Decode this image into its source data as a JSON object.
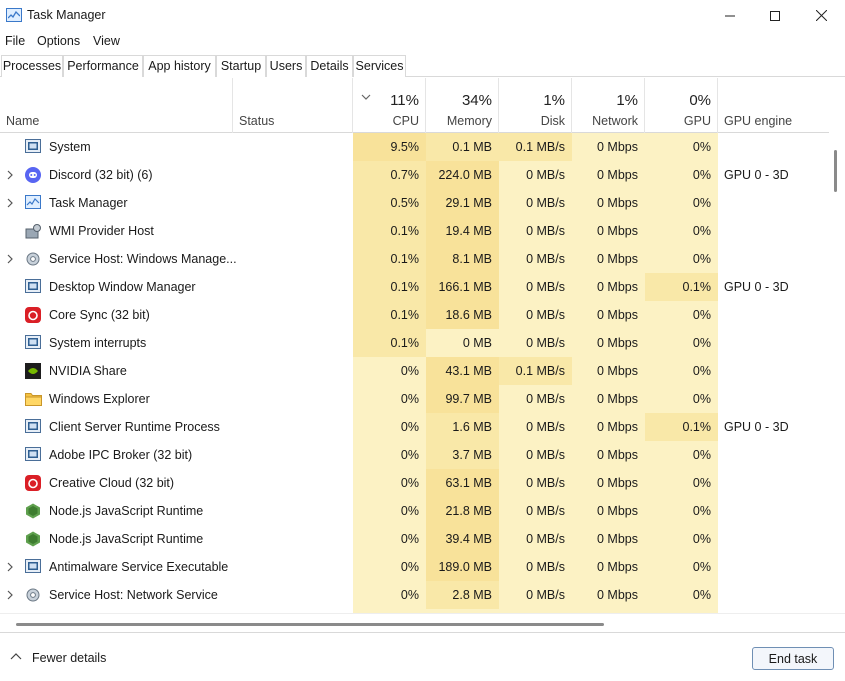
{
  "window": {
    "title": "Task Manager"
  },
  "menu": [
    "File",
    "Options",
    "View"
  ],
  "tabs": [
    "Processes",
    "Performance",
    "App history",
    "Startup",
    "Users",
    "Details",
    "Services"
  ],
  "columns": {
    "name": "Name",
    "status": "Status",
    "cpu": {
      "pct": "11%",
      "label": "CPU"
    },
    "memory": {
      "pct": "34%",
      "label": "Memory"
    },
    "disk": {
      "pct": "1%",
      "label": "Disk"
    },
    "network": {
      "pct": "1%",
      "label": "Network"
    },
    "gpu": {
      "pct": "0%",
      "label": "GPU"
    },
    "gpu_engine": "GPU engine"
  },
  "processes": [
    {
      "name": "System",
      "expandable": false,
      "icon": "system-icon",
      "cpu": "9.5%",
      "memory": "0.1 MB",
      "disk": "0.1 MB/s",
      "network": "0 Mbps",
      "gpu": "0%",
      "gpu_engine": ""
    },
    {
      "name": "Discord (32 bit) (6)",
      "expandable": true,
      "icon": "discord-icon",
      "cpu": "0.7%",
      "memory": "224.0 MB",
      "disk": "0 MB/s",
      "network": "0 Mbps",
      "gpu": "0%",
      "gpu_engine": "GPU 0 - 3D"
    },
    {
      "name": "Task Manager",
      "expandable": true,
      "icon": "task-manager-icon",
      "cpu": "0.5%",
      "memory": "29.1 MB",
      "disk": "0 MB/s",
      "network": "0 Mbps",
      "gpu": "0%",
      "gpu_engine": ""
    },
    {
      "name": "WMI Provider Host",
      "expandable": false,
      "icon": "wmi-icon",
      "cpu": "0.1%",
      "memory": "19.4 MB",
      "disk": "0 MB/s",
      "network": "0 Mbps",
      "gpu": "0%",
      "gpu_engine": ""
    },
    {
      "name": "Service Host: Windows Manage...",
      "expandable": true,
      "icon": "gear-icon",
      "cpu": "0.1%",
      "memory": "8.1 MB",
      "disk": "0 MB/s",
      "network": "0 Mbps",
      "gpu": "0%",
      "gpu_engine": ""
    },
    {
      "name": "Desktop Window Manager",
      "expandable": false,
      "icon": "system-icon",
      "cpu": "0.1%",
      "memory": "166.1 MB",
      "disk": "0 MB/s",
      "network": "0 Mbps",
      "gpu": "0.1%",
      "gpu_engine": "GPU 0 - 3D"
    },
    {
      "name": "Core Sync (32 bit)",
      "expandable": false,
      "icon": "creative-cloud-icon",
      "cpu": "0.1%",
      "memory": "18.6 MB",
      "disk": "0 MB/s",
      "network": "0 Mbps",
      "gpu": "0%",
      "gpu_engine": ""
    },
    {
      "name": "System interrupts",
      "expandable": false,
      "icon": "system-icon",
      "cpu": "0.1%",
      "memory": "0 MB",
      "disk": "0 MB/s",
      "network": "0 Mbps",
      "gpu": "0%",
      "gpu_engine": ""
    },
    {
      "name": "NVIDIA Share",
      "expandable": false,
      "icon": "nvidia-icon",
      "cpu": "0%",
      "memory": "43.1 MB",
      "disk": "0.1 MB/s",
      "network": "0 Mbps",
      "gpu": "0%",
      "gpu_engine": ""
    },
    {
      "name": "Windows Explorer",
      "expandable": false,
      "icon": "folder-icon",
      "cpu": "0%",
      "memory": "99.7 MB",
      "disk": "0 MB/s",
      "network": "0 Mbps",
      "gpu": "0%",
      "gpu_engine": ""
    },
    {
      "name": "Client Server Runtime Process",
      "expandable": false,
      "icon": "system-icon",
      "cpu": "0%",
      "memory": "1.6 MB",
      "disk": "0 MB/s",
      "network": "0 Mbps",
      "gpu": "0.1%",
      "gpu_engine": "GPU 0 - 3D"
    },
    {
      "name": "Adobe IPC Broker (32 bit)",
      "expandable": false,
      "icon": "system-icon",
      "cpu": "0%",
      "memory": "3.7 MB",
      "disk": "0 MB/s",
      "network": "0 Mbps",
      "gpu": "0%",
      "gpu_engine": ""
    },
    {
      "name": "Creative Cloud (32 bit)",
      "expandable": false,
      "icon": "creative-cloud-icon",
      "cpu": "0%",
      "memory": "63.1 MB",
      "disk": "0 MB/s",
      "network": "0 Mbps",
      "gpu": "0%",
      "gpu_engine": ""
    },
    {
      "name": "Node.js JavaScript Runtime",
      "expandable": false,
      "icon": "nodejs-icon",
      "cpu": "0%",
      "memory": "21.8 MB",
      "disk": "0 MB/s",
      "network": "0 Mbps",
      "gpu": "0%",
      "gpu_engine": ""
    },
    {
      "name": "Node.js JavaScript Runtime",
      "expandable": false,
      "icon": "nodejs-icon",
      "cpu": "0%",
      "memory": "39.4 MB",
      "disk": "0 MB/s",
      "network": "0 Mbps",
      "gpu": "0%",
      "gpu_engine": ""
    },
    {
      "name": "Antimalware Service Executable",
      "expandable": true,
      "icon": "system-icon",
      "cpu": "0%",
      "memory": "189.0 MB",
      "disk": "0 MB/s",
      "network": "0 Mbps",
      "gpu": "0%",
      "gpu_engine": ""
    },
    {
      "name": "Service Host: Network Service",
      "expandable": true,
      "icon": "gear-icon",
      "cpu": "0%",
      "memory": "2.8 MB",
      "disk": "0 MB/s",
      "network": "0 Mbps",
      "gpu": "0%",
      "gpu_engine": ""
    }
  ],
  "footer": {
    "fewer_details": "Fewer details",
    "end_task": "End task"
  },
  "colors": {
    "heat_low": "#fcf2c4",
    "heat_mid": "#f9e8a8",
    "heat_high": "#f8e29a",
    "accent": "#3a78c9"
  }
}
